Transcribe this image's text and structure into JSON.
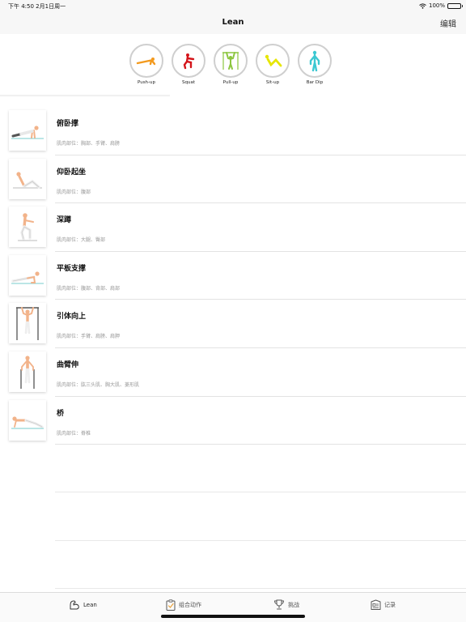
{
  "status": {
    "time_date": "下午 4:50   2月1日周一",
    "battery": "100%"
  },
  "nav": {
    "title": "Lean",
    "edit": "编辑"
  },
  "categories": [
    {
      "label": "Push-up",
      "color": "#f39a1e"
    },
    {
      "label": "Squat",
      "color": "#d4141a"
    },
    {
      "label": "Pull-up",
      "color": "#8cc63f"
    },
    {
      "label": "Sit-up",
      "color": "#e6e600"
    },
    {
      "label": "Bar Dip",
      "color": "#3cc8d2"
    }
  ],
  "exercises": [
    {
      "name": "俯卧撑",
      "muscles": "肌肉部位：胸部、手臂、肩膀",
      "icon": "pushup-figure-icon"
    },
    {
      "name": "仰卧起坐",
      "muscles": "肌肉部位：腹部",
      "icon": "situp-figure-icon"
    },
    {
      "name": "深蹲",
      "muscles": "肌肉部位：大腿、臀部",
      "icon": "squat-figure-icon"
    },
    {
      "name": "平板支撑",
      "muscles": "肌肉部位：腹部、背部、肩部",
      "icon": "plank-figure-icon"
    },
    {
      "name": "引体向上",
      "muscles": "肌肉部位：手臂、肩膀、肩胛",
      "icon": "pullup-figure-icon"
    },
    {
      "name": "曲臂伸",
      "muscles": "肌肉部位：肱三头肌、胸大肌、菱形肌",
      "icon": "dip-figure-icon"
    },
    {
      "name": "桥",
      "muscles": "肌肉部位：脊椎",
      "icon": "bridge-figure-icon"
    }
  ],
  "tabs": [
    {
      "label": "Lean",
      "icon": "arm-flex-icon",
      "active": true
    },
    {
      "label": "组合动作",
      "icon": "clipboard-check-icon",
      "active": false
    },
    {
      "label": "挑战",
      "icon": "trophy-icon",
      "active": false
    },
    {
      "label": "记录",
      "icon": "record-card-icon",
      "active": false
    }
  ]
}
